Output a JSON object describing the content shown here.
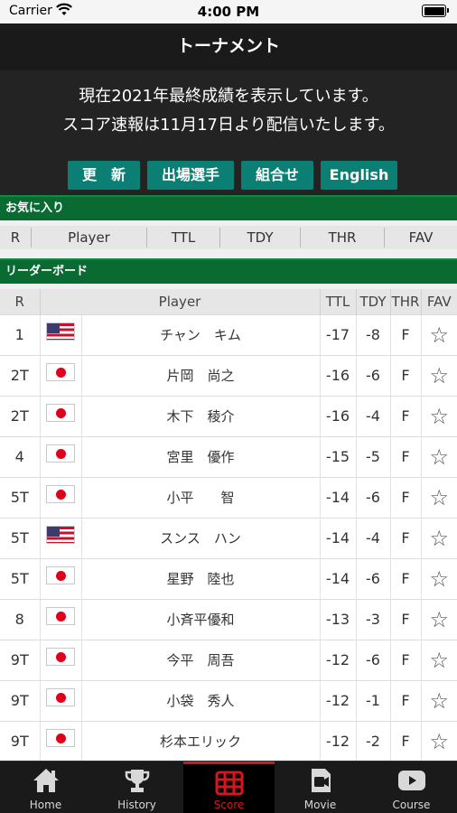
{
  "status_bar": {
    "carrier": "Carrier",
    "time": "4:00 PM"
  },
  "nav": {
    "title": "トーナメント"
  },
  "notice": {
    "line1": "現在2021年最終成績を表示しています。",
    "line2": "スコア速報は11月17日より配信いたします。"
  },
  "buttons": {
    "refresh": "更　新",
    "players": "出場選手",
    "groups": "組合せ",
    "english": "English"
  },
  "favorites": {
    "title": "お気に入り",
    "columns": {
      "rank": "R",
      "player": "Player",
      "ttl": "TTL",
      "tdy": "TDY",
      "thr": "THR",
      "fav": "FAV"
    }
  },
  "leaderboard": {
    "title": "リーダーボード",
    "columns": {
      "rank": "R",
      "player": "Player",
      "ttl": "TTL",
      "tdy": "TDY",
      "thr": "THR",
      "fav": "FAV"
    },
    "rows": [
      {
        "rank": "1",
        "flag": "us",
        "name": "チャン　キム",
        "ttl": "-17",
        "tdy": "-8",
        "thr": "F",
        "fav": "☆"
      },
      {
        "rank": "2T",
        "flag": "jp",
        "name": "片岡　尚之",
        "ttl": "-16",
        "tdy": "-6",
        "thr": "F",
        "fav": "☆"
      },
      {
        "rank": "2T",
        "flag": "jp",
        "name": "木下　稜介",
        "ttl": "-16",
        "tdy": "-4",
        "thr": "F",
        "fav": "☆"
      },
      {
        "rank": "4",
        "flag": "jp",
        "name": "宮里　優作",
        "ttl": "-15",
        "tdy": "-5",
        "thr": "F",
        "fav": "☆"
      },
      {
        "rank": "5T",
        "flag": "jp",
        "name": "小平　　智",
        "ttl": "-14",
        "tdy": "-6",
        "thr": "F",
        "fav": "☆"
      },
      {
        "rank": "5T",
        "flag": "us",
        "name": "スンス　ハン",
        "ttl": "-14",
        "tdy": "-4",
        "thr": "F",
        "fav": "☆"
      },
      {
        "rank": "5T",
        "flag": "jp",
        "name": "星野　陸也",
        "ttl": "-14",
        "tdy": "-6",
        "thr": "F",
        "fav": "☆"
      },
      {
        "rank": "8",
        "flag": "jp",
        "name": "小斉平優和",
        "ttl": "-13",
        "tdy": "-3",
        "thr": "F",
        "fav": "☆"
      },
      {
        "rank": "9T",
        "flag": "jp",
        "name": "今平　周吾",
        "ttl": "-12",
        "tdy": "-6",
        "thr": "F",
        "fav": "☆"
      },
      {
        "rank": "9T",
        "flag": "jp",
        "name": "小袋　秀人",
        "ttl": "-12",
        "tdy": "-1",
        "thr": "F",
        "fav": "☆"
      },
      {
        "rank": "9T",
        "flag": "jp",
        "name": "杉本エリック",
        "ttl": "-12",
        "tdy": "-2",
        "thr": "F",
        "fav": "☆"
      }
    ]
  },
  "tabs": [
    {
      "label": "Home",
      "icon": "home-icon"
    },
    {
      "label": "History",
      "icon": "trophy-icon"
    },
    {
      "label": "Score",
      "icon": "scoreboard-icon",
      "active": true
    },
    {
      "label": "Movie",
      "icon": "movie-icon"
    },
    {
      "label": "Course",
      "icon": "play-icon"
    }
  ],
  "colors": {
    "accent_green": "#0a6b32",
    "button_teal": "#0b7f74",
    "active_tab": "#d6161e"
  }
}
